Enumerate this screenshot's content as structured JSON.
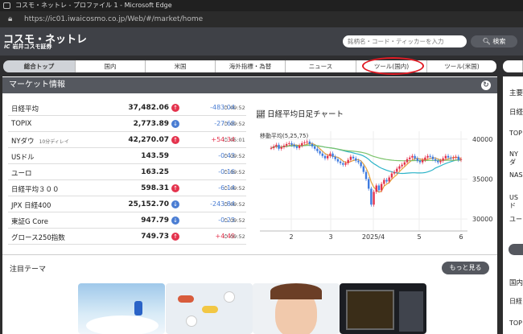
{
  "window": {
    "title": "コスモ・ネットレ - プロファイル 1 - Microsoft Edge",
    "url": "https://ic01.iwaicosmo.co.jp/Web/#/market/home"
  },
  "brand": {
    "name": "コスモ・ネットレ",
    "sub": "岩井コスモ証券"
  },
  "search": {
    "placeholder": "銘柄名・コード・ティッカーを入力",
    "button": "検索"
  },
  "nav": {
    "tabs": [
      "総合トップ",
      "国内",
      "米国",
      "海外指標・為替",
      "ニュース",
      "ツール(国内)",
      "ツール(米国)"
    ]
  },
  "market": {
    "header": "マーケット情報",
    "rows": [
      {
        "name": "日経平均",
        "sub": "",
        "value": "37,482.06",
        "dir": "up",
        "change": "-483.04",
        "time": "09:52"
      },
      {
        "name": "TOPIX",
        "sub": "",
        "value": "2,773.89",
        "dir": "down",
        "change": "-27.68",
        "time": "09:52"
      },
      {
        "name": "NYダウ",
        "sub": "10分ディレイ",
        "value": "42,270.07",
        "dir": "up",
        "change": "+54.34",
        "time": "05:01"
      },
      {
        "name": "USドル",
        "sub": "",
        "value": "143.59",
        "dir": "none",
        "change": "-0.43",
        "time": "09:52"
      },
      {
        "name": "ユーロ",
        "sub": "",
        "value": "163.25",
        "dir": "none",
        "change": "-0.16",
        "time": "09:52"
      },
      {
        "name": "日経平均３００",
        "sub": "",
        "value": "598.31",
        "dir": "up",
        "change": "-6.14",
        "time": "09:52"
      },
      {
        "name": "JPX 日経400",
        "sub": "",
        "value": "25,152.70",
        "dir": "down",
        "change": "-243.84",
        "time": "09:52"
      },
      {
        "name": "東証G Core",
        "sub": "",
        "value": "947.79",
        "dir": "down",
        "change": "-0.23",
        "time": "09:52"
      },
      {
        "name": "グロース250指数",
        "sub": "",
        "value": "749.73",
        "dir": "up",
        "change": "+4.49",
        "time": "09:52"
      }
    ]
  },
  "chart": {
    "title": "日経平均日足チャート",
    "legend": "移動平均(5,25,75)"
  },
  "chart_data": {
    "type": "line",
    "title": "日経平均日足チャート",
    "ylim": [
      28500,
      41000
    ],
    "yticks": [
      40000,
      35000,
      30000
    ],
    "xticks": [
      "2",
      "3",
      "2025/4",
      "5",
      "6"
    ],
    "series": [
      {
        "name": "日経平均",
        "values": [
          38900,
          39100,
          39300,
          38800,
          39000,
          39200,
          39400,
          39500,
          39300,
          39100,
          38900,
          39200,
          39500,
          39600,
          39700,
          39400,
          39100,
          38800,
          38500,
          38200,
          37900,
          37600,
          37900,
          38200,
          37800,
          37500,
          37200,
          37000,
          36800,
          37000,
          37400,
          37800,
          37600,
          37300,
          37100,
          36600,
          35900,
          35000,
          33800,
          31800,
          33400,
          34200,
          33600,
          34400,
          34900,
          34700,
          35200,
          35700,
          35900,
          36300,
          36600,
          36800,
          37100,
          37500,
          37700,
          37900,
          37600,
          37300,
          37100,
          37400,
          37700,
          37900,
          37800,
          37500,
          37300,
          37100,
          37300,
          37600,
          37900,
          37700,
          37600,
          37700,
          37800,
          37400,
          37500
        ]
      }
    ]
  },
  "rightpanel": {
    "header": "主要",
    "labels": [
      "日経",
      "TOP",
      "NYダ",
      "NAS",
      "USド",
      "ユー"
    ],
    "bottom": [
      "国内",
      "日経",
      "TOP"
    ]
  },
  "topics": {
    "title": "注目テーマ",
    "more": "もっと見る"
  }
}
